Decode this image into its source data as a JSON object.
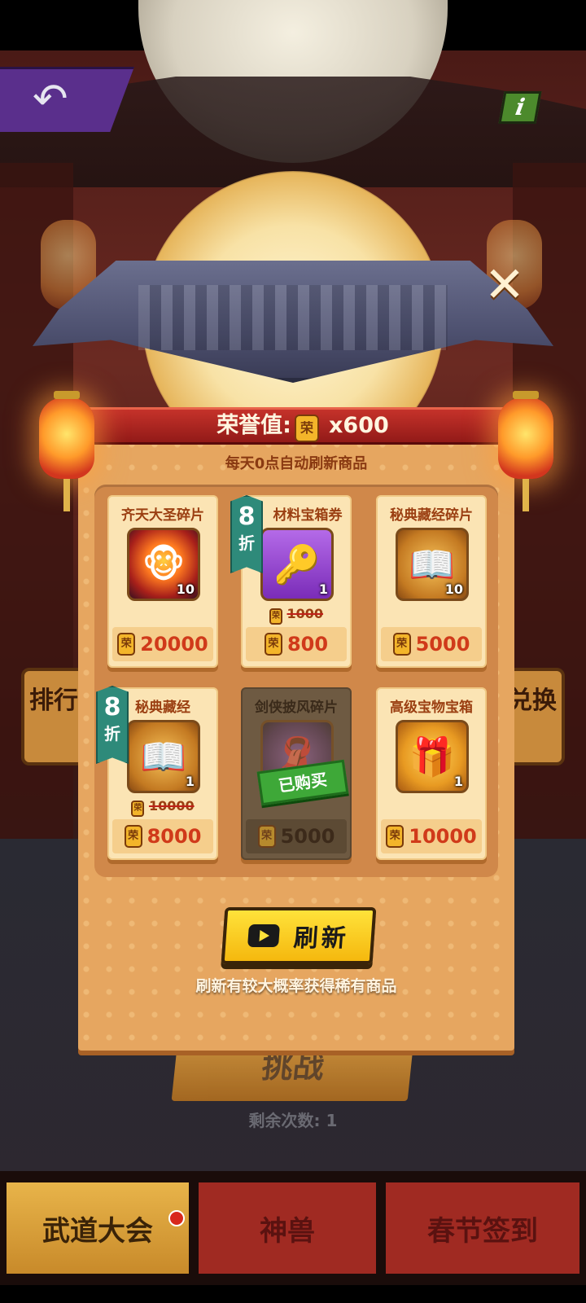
{
  "header": {
    "honor_label": "荣誉值:",
    "honor_value": "x600",
    "coin_glyph": "荣",
    "subtitle": "每天0点自动刷新商品"
  },
  "side_menu": {
    "left_label": "排行",
    "right_label": "兑换"
  },
  "items": [
    {
      "name": "齐天大圣碎片",
      "qty": "10",
      "price": "20000",
      "icon": "monkey-king-icon"
    },
    {
      "name": "材料宝箱券",
      "qty": "1",
      "old_price": "1000",
      "price": "800",
      "discount": "8",
      "discount_unit": "折",
      "icon": "key-icon"
    },
    {
      "name": "秘典藏经碎片",
      "qty": "10",
      "price": "5000",
      "icon": "book-icon"
    },
    {
      "name": "秘典藏经",
      "qty": "1",
      "old_price": "10000",
      "price": "8000",
      "discount": "8",
      "discount_unit": "折",
      "icon": "book-icon"
    },
    {
      "name": "剑侠披风碎片",
      "price": "5000",
      "status": "已购买",
      "icon": "cape-icon"
    },
    {
      "name": "高级宝物宝箱",
      "qty": "1",
      "price": "10000",
      "icon": "chest-icon"
    }
  ],
  "refresh": {
    "label": "刷新",
    "hint": "刷新有较大概率获得稀有商品"
  },
  "challenge": {
    "label": "挑战",
    "remaining": "剩余次数: 1"
  },
  "tabs": [
    {
      "label": "武道大会",
      "active": true
    },
    {
      "label": "神兽",
      "active": false
    },
    {
      "label": "春节签到",
      "active": false
    }
  ],
  "colors": {
    "panel": "#e6a660",
    "header_red": "#c5322a",
    "price_red": "#d03a1a",
    "discount_teal": "#2e8a7a",
    "refresh_yellow": "#ffe23a"
  }
}
